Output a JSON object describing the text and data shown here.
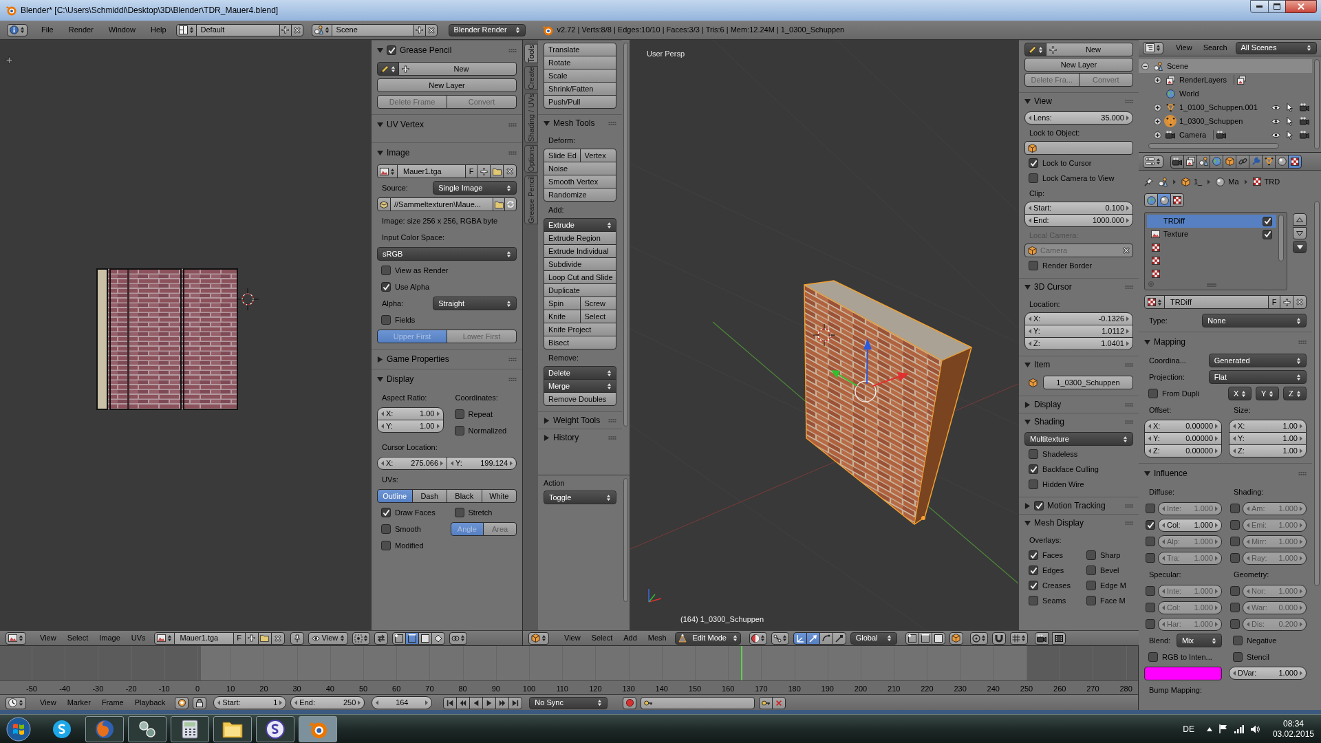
{
  "window": {
    "title": "Blender* [C:\\Users\\Schmiddi\\Desktop\\3D\\Blender\\TDR_Mauer4.blend]"
  },
  "info_header": {
    "menus": [
      "File",
      "Render",
      "Window",
      "Help"
    ],
    "layout": "Default",
    "scene": "Scene",
    "engine": "Blender Render",
    "stats": "v2.72 | Verts:8/8 | Edges:10/10 | Faces:3/3 | Tris:6 | Mem:12.24M | 1_0300_Schuppen"
  },
  "image_editor": {
    "sidebar": [
      {
        "title": "Grease Pencil",
        "expanded": true,
        "checkbox": true,
        "rows": [
          {
            "kind": "new_row",
            "label": "New"
          },
          {
            "kind": "group",
            "rows": [
              [
                {
                  "kind": "button",
                  "label": "New Layer"
                }
              ]
            ]
          },
          {
            "kind": "group",
            "rows": [
              [
                {
                  "kind": "button",
                  "label": "Delete Frame",
                  "disabled": true
                },
                {
                  "kind": "button",
                  "label": "Convert",
                  "disabled": true
                }
              ]
            ]
          }
        ]
      },
      {
        "title": "UV Vertex",
        "expanded": true
      },
      {
        "title": "Image",
        "expanded": true,
        "rows": [
          {
            "kind": "datablock",
            "value": "Mauer1.tga",
            "fake_user": "F"
          },
          {
            "kind": "dropdown",
            "label": "Source:",
            "value": "Single Image"
          },
          {
            "kind": "path",
            "value": "//Sammeltexturen\\Maue..."
          },
          {
            "kind": "label",
            "text": "Image: size 256 x 256, RGBA byte"
          },
          {
            "kind": "label",
            "text": "Input Color Space:"
          },
          {
            "kind": "dropdown",
            "value": "sRGB"
          },
          {
            "kind": "checkbox",
            "label": "View as Render",
            "checked": false
          },
          {
            "kind": "checkbox",
            "label": "Use Alpha",
            "checked": true
          },
          {
            "kind": "dropdown",
            "label": "Alpha:",
            "value": "Straight"
          },
          {
            "kind": "checkbox",
            "label": "Fields",
            "checked": false
          },
          {
            "kind": "group",
            "rows": [
              [
                {
                  "kind": "button",
                  "label": "Upper First",
                  "selected": true,
                  "disabled": true
                },
                {
                  "kind": "button",
                  "label": "Lower First",
                  "selected": false,
                  "disabled": true
                }
              ]
            ]
          }
        ]
      },
      {
        "title": "Game Properties",
        "expanded": false
      },
      {
        "title": "Display",
        "expanded": true,
        "rows": [
          {
            "kind": "columns",
            "columns": [
              [
                {
                  "kind": "label",
                  "text": "Aspect Ratio:"
                },
                {
                  "kind": "fields",
                  "items": [
                    {
                      "label": "X:",
                      "value": "1.00"
                    },
                    {
                      "label": "Y:",
                      "value": "1.00"
                    }
                  ]
                }
              ],
              [
                {
                  "kind": "label",
                  "text": "Coordinates:"
                },
                {
                  "kind": "checkbox",
                  "label": "Repeat",
                  "checked": false
                },
                {
                  "kind": "checkbox",
                  "label": "Normalized",
                  "checked": false
                }
              ]
            ]
          },
          {
            "kind": "label",
            "text": "Cursor Location:"
          },
          {
            "kind": "fields_row",
            "items": [
              {
                "label": "X:",
                "value": "275.066"
              },
              {
                "label": "Y:",
                "value": "199.124"
              }
            ]
          },
          {
            "kind": "label",
            "text": "UVs:"
          },
          {
            "kind": "group",
            "rows": [
              [
                {
                  "kind": "button",
                  "label": "Outline",
                  "selected": true
                },
                {
                  "kind": "button",
                  "label": "Dash",
                  "selected": false
                },
                {
                  "kind": "button",
                  "label": "Black",
                  "selected": false
                },
                {
                  "kind": "button",
                  "label": "White",
                  "selected": false
                }
              ]
            ]
          },
          {
            "kind": "columns",
            "columns": [
              [
                {
                  "kind": "checkbox",
                  "label": "Draw Faces",
                  "checked": true
                },
                {
                  "kind": "checkbox",
                  "label": "Smooth",
                  "checked": false
                },
                {
                  "kind": "checkbox",
                  "label": "Modified",
                  "checked": false
                }
              ],
              [
                {
                  "kind": "checkbox",
                  "label": "Stretch",
                  "checked": false
                },
                {
                  "kind": "group",
                  "rows": [
                    [
                      {
                        "kind": "button",
                        "label": "Angle",
                        "selected": true,
                        "disabled": true
                      },
                      {
                        "kind": "button",
                        "label": "Area",
                        "selected": false,
                        "disabled": true
                      }
                    ]
                  ]
                }
              ]
            ]
          }
        ]
      }
    ],
    "header": {
      "menus": [
        "View",
        "Select",
        "Image",
        "UVs"
      ],
      "image": "Mauer1.tga",
      "fake_user": "F",
      "view_mode": "View"
    }
  },
  "view3d": {
    "tool_tabs": [
      {
        "label": "Tools",
        "selected": true
      },
      {
        "label": "Create",
        "selected": false
      },
      {
        "label": "Shading / UVs",
        "selected": false
      },
      {
        "label": "Options",
        "selected": false
      },
      {
        "label": "Grease Pencil",
        "selected": false
      }
    ],
    "tool_panels": [
      {
        "rows": [
          {
            "kind": "group",
            "rows": [
              [
                {
                  "kind": "button",
                  "label": "Translate"
                }
              ],
              [
                {
                  "kind": "button",
                  "label": "Rotate"
                }
              ],
              [
                {
                  "kind": "button",
                  "label": "Scale"
                }
              ],
              [
                {
                  "kind": "button",
                  "label": "Shrink/Fatten"
                }
              ],
              [
                {
                  "kind": "button",
                  "label": "Push/Pull"
                }
              ]
            ]
          }
        ]
      },
      {
        "title": "Mesh Tools",
        "expanded": true,
        "rows": [
          {
            "kind": "label",
            "text": "Deform:"
          },
          {
            "kind": "group",
            "rows": [
              [
                {
                  "kind": "button",
                  "label": "Slide Ed"
                },
                {
                  "kind": "button",
                  "label": "Vertex"
                }
              ],
              [
                {
                  "kind": "button",
                  "label": "Noise"
                }
              ],
              [
                {
                  "kind": "button",
                  "label": "Smooth Vertex"
                }
              ],
              [
                {
                  "kind": "button",
                  "label": "Randomize"
                }
              ]
            ]
          },
          {
            "kind": "label",
            "text": "Add:"
          },
          {
            "kind": "group",
            "rows": [
              [
                {
                  "kind": "menu",
                  "label": "Extrude"
                }
              ],
              [
                {
                  "kind": "button",
                  "label": "Extrude Region"
                }
              ],
              [
                {
                  "kind": "button",
                  "label": "Extrude Individual"
                }
              ],
              [
                {
                  "kind": "button",
                  "label": "Subdivide"
                }
              ],
              [
                {
                  "kind": "button",
                  "label": "Loop Cut and Slide"
                }
              ],
              [
                {
                  "kind": "button",
                  "label": "Duplicate"
                }
              ],
              [
                {
                  "kind": "button",
                  "label": "Spin"
                },
                {
                  "kind": "button",
                  "label": "Screw"
                }
              ],
              [
                {
                  "kind": "button",
                  "label": "Knife"
                },
                {
                  "kind": "button",
                  "label": "Select"
                }
              ],
              [
                {
                  "kind": "button",
                  "label": "Knife Project"
                }
              ],
              [
                {
                  "kind": "button",
                  "label": "Bisect"
                }
              ]
            ]
          },
          {
            "kind": "label",
            "text": "Remove:"
          },
          {
            "kind": "group",
            "rows": [
              [
                {
                  "kind": "menu",
                  "label": "Delete"
                }
              ],
              [
                {
                  "kind": "menu",
                  "label": "Merge"
                }
              ],
              [
                {
                  "kind": "button",
                  "label": "Remove Doubles"
                }
              ]
            ]
          }
        ]
      },
      {
        "title": "Weight Tools",
        "expanded": false
      },
      {
        "title": "History",
        "expanded": false
      }
    ],
    "operator": {
      "title": "Action",
      "value": "Toggle"
    },
    "viewport": {
      "view_name": "User Persp",
      "object_info": "(164) 1_0300_Schuppen"
    },
    "sidebar": [
      {
        "rows": [
          {
            "kind": "new_row",
            "label": "New"
          },
          {
            "kind": "group",
            "rows": [
              [
                {
                  "kind": "button",
                  "label": "New Layer"
                }
              ]
            ]
          },
          {
            "kind": "group",
            "rows": [
              [
                {
                  "kind": "button",
                  "label": "Delete Fra...",
                  "disabled": true
                },
                {
                  "kind": "button",
                  "label": "Convert",
                  "disabled": true
                }
              ]
            ]
          }
        ]
      },
      {
        "title": "View",
        "expanded": true,
        "rows": [
          {
            "kind": "fields",
            "items": [
              {
                "label": "Lens:",
                "value": "35.000"
              }
            ]
          },
          {
            "kind": "label",
            "text": "Lock to Object:"
          },
          {
            "kind": "object_field"
          },
          {
            "kind": "checkbox",
            "label": "Lock to Cursor",
            "checked": true
          },
          {
            "kind": "checkbox",
            "label": "Lock Camera to View",
            "checked": false
          },
          {
            "kind": "label",
            "text": "Clip:"
          },
          {
            "kind": "fields",
            "items": [
              {
                "label": "Start:",
                "value": "0.100"
              },
              {
                "label": "End:",
                "value": "1000.000"
              }
            ]
          },
          {
            "kind": "label",
            "text": "Local Camera:",
            "disabled": true
          },
          {
            "kind": "object_field",
            "value": "Camera",
            "disabled": true
          },
          {
            "kind": "checkbox",
            "label": "Render Border",
            "checked": false
          }
        ]
      },
      {
        "title": "3D Cursor",
        "expanded": true,
        "rows": [
          {
            "kind": "label",
            "text": "Location:"
          },
          {
            "kind": "fields",
            "items": [
              {
                "label": "X:",
                "value": "-0.1326"
              },
              {
                "label": "Y:",
                "value": "1.0112"
              },
              {
                "label": "Z:",
                "value": "1.0401"
              }
            ]
          }
        ]
      },
      {
        "title": "Item",
        "expanded": true,
        "rows": [
          {
            "kind": "name_field",
            "value": "1_0300_Schuppen"
          }
        ]
      },
      {
        "title": "Display",
        "expanded": false
      },
      {
        "title": "Shading",
        "expanded": true,
        "rows": [
          {
            "kind": "dropdown",
            "value": "Multitexture"
          },
          {
            "kind": "checkbox",
            "label": "Shadeless",
            "checked": false
          },
          {
            "kind": "checkbox",
            "label": "Backface Culling",
            "checked": true
          },
          {
            "kind": "checkbox",
            "label": "Hidden Wire",
            "checked": false
          }
        ]
      },
      {
        "title": "Motion Tracking",
        "expanded": false,
        "checkbox": true
      },
      {
        "title": "Mesh Display",
        "expanded": true,
        "rows": [
          {
            "kind": "label",
            "text": "Overlays:"
          },
          {
            "kind": "columns",
            "columns": [
              [
                {
                  "kind": "checkbox",
                  "label": "Faces",
                  "checked": true
                },
                {
                  "kind": "checkbox",
                  "label": "Edges",
                  "checked": true
                },
                {
                  "kind": "checkbox",
                  "label": "Creases",
                  "checked": true
                },
                {
                  "kind": "checkbox",
                  "label": "Seams",
                  "checked": false
                }
              ],
              [
                {
                  "kind": "checkbox",
                  "label": "Sharp",
                  "checked": false
                },
                {
                  "kind": "checkbox",
                  "label": "Bevel",
                  "checked": false
                },
                {
                  "kind": "checkbox",
                  "label": "Edge M",
                  "checked": false
                },
                {
                  "kind": "checkbox",
                  "label": "Face M",
                  "checked": false
                }
              ]
            ]
          }
        ]
      }
    ],
    "header": {
      "menus": [
        "View",
        "Select",
        "Add",
        "Mesh"
      ],
      "mode": "Edit Mode",
      "manipulators": [
        {
          "selected": true
        },
        {
          "selected": true
        },
        {
          "selected": false
        },
        {
          "selected": false
        }
      ],
      "orientation": "Global"
    }
  },
  "outliner": {
    "menus": [
      "View",
      "Search"
    ],
    "display_mode": "All Scenes",
    "tree": [
      {
        "name": "Scene",
        "kind": "scene",
        "expanded": true,
        "selected": true,
        "children": [
          {
            "name": "RenderLayers",
            "kind": "renderlayers",
            "expanded": false,
            "selected": false,
            "active": false
          },
          {
            "name": "World",
            "kind": "world",
            "selected": false,
            "active": false
          },
          {
            "name": "1_0100_Schuppen.001",
            "kind": "mesh",
            "expanded": false,
            "selected": false,
            "active": false
          },
          {
            "name": "1_0300_Schuppen",
            "kind": "mesh",
            "expanded": false,
            "selected": false,
            "active": true
          },
          {
            "name": "Camera",
            "kind": "camera",
            "expanded": false,
            "selected": false,
            "active": false
          }
        ]
      }
    ]
  },
  "properties": {
    "context_tabs": [
      {
        "kind": "render",
        "selected": false
      },
      {
        "kind": "render_layers",
        "selected": false
      },
      {
        "kind": "scene",
        "selected": false
      },
      {
        "kind": "world",
        "selected": false
      },
      {
        "kind": "object",
        "selected": false
      },
      {
        "kind": "constraints",
        "selected": false
      },
      {
        "kind": "modifiers",
        "selected": false
      },
      {
        "kind": "data",
        "selected": false
      },
      {
        "kind": "material",
        "selected": false
      },
      {
        "kind": "texture",
        "selected": true
      }
    ],
    "breadcrumb": [
      {
        "kind": "scene"
      },
      {
        "kind": "object",
        "label": "1_"
      },
      {
        "kind": "material",
        "label": "Ma"
      },
      {
        "kind": "texture",
        "label": "TRD"
      }
    ],
    "texture_contexts": [
      {
        "kind": "world",
        "selected": false
      },
      {
        "kind": "material",
        "selected": true
      },
      {
        "kind": "texture",
        "selected": false
      }
    ],
    "slots": [
      {
        "name": "TRDiff",
        "kind": "blank",
        "selected": true,
        "checked": true
      },
      {
        "name": "Texture",
        "kind": "image",
        "selected": false,
        "checked": true
      },
      {
        "kind": "texture",
        "selected": false
      },
      {
        "kind": "texture",
        "selected": false
      },
      {
        "kind": "texture",
        "selected": false
      }
    ],
    "texture_name": "TRDiff",
    "fake_user": "F",
    "type": {
      "label": "Type:",
      "value": "None"
    },
    "panels": [
      {
        "title": "Mapping",
        "expanded": true,
        "rows": [
          {
            "kind": "dropdown",
            "label": "Coordina...",
            "value": "Generated"
          },
          {
            "kind": "dropdown",
            "label": "Projection:",
            "value": "Flat"
          },
          {
            "kind": "check_menus",
            "label": "From Dupli",
            "checked": false,
            "menus": [
              "X",
              "Y",
              "Z"
            ]
          },
          {
            "kind": "columns",
            "columns": [
              [
                {
                  "kind": "label",
                  "text": "Offset:"
                },
                {
                  "kind": "fields",
                  "items": [
                    {
                      "label": "X:",
                      "value": "0.00000"
                    },
                    {
                      "label": "Y:",
                      "value": "0.00000"
                    },
                    {
                      "label": "Z:",
                      "value": "0.00000"
                    }
                  ]
                }
              ],
              [
                {
                  "kind": "label",
                  "text": "Size:"
                },
                {
                  "kind": "fields",
                  "items": [
                    {
                      "label": "X:",
                      "value": "1.00"
                    },
                    {
                      "label": "Y:",
                      "value": "1.00"
                    },
                    {
                      "label": "Z:",
                      "value": "1.00"
                    }
                  ]
                }
              ]
            ]
          }
        ]
      },
      {
        "title": "Influence",
        "expanded": true,
        "rows": [
          {
            "kind": "columns",
            "columns": [
              [
                {
                  "kind": "label",
                  "text": "Diffuse:"
                },
                {
                  "kind": "check_field",
                  "checked": false,
                  "label": "Inte:",
                  "value": "1.000"
                },
                {
                  "kind": "check_field",
                  "checked": true,
                  "label": "Col:",
                  "value": "1.000"
                },
                {
                  "kind": "check_field",
                  "checked": false,
                  "label": "Alp:",
                  "value": "1.000"
                },
                {
                  "kind": "check_field",
                  "checked": false,
                  "label": "Tra:",
                  "value": "1.000"
                }
              ],
              [
                {
                  "kind": "label",
                  "text": "Shading:"
                },
                {
                  "kind": "check_field",
                  "checked": false,
                  "label": "Am:",
                  "value": "1.000"
                },
                {
                  "kind": "check_field",
                  "checked": false,
                  "label": "Emi:",
                  "value": "1.000"
                },
                {
                  "kind": "check_field",
                  "checked": false,
                  "label": "Mirr:",
                  "value": "1.000"
                },
                {
                  "kind": "check_field",
                  "checked": false,
                  "label": "Ray:",
                  "value": "1.000"
                }
              ]
            ]
          },
          {
            "kind": "columns",
            "columns": [
              [
                {
                  "kind": "label",
                  "text": "Specular:"
                },
                {
                  "kind": "check_field",
                  "checked": false,
                  "label": "Inte:",
                  "value": "1.000"
                },
                {
                  "kind": "check_field",
                  "checked": false,
                  "label": "Col:",
                  "value": "1.000"
                },
                {
                  "kind": "check_field",
                  "checked": false,
                  "label": "Har:",
                  "value": "1.000"
                }
              ],
              [
                {
                  "kind": "label",
                  "text": "Geometry:"
                },
                {
                  "kind": "check_field",
                  "checked": false,
                  "label": "Nor:",
                  "value": "1.000"
                },
                {
                  "kind": "check_field",
                  "checked": false,
                  "label": "War:",
                  "value": "0.000"
                },
                {
                  "kind": "check_field",
                  "checked": false,
                  "label": "Dis:",
                  "value": "0.200"
                }
              ]
            ]
          },
          {
            "kind": "columns",
            "columns": [
              [
                {
                  "kind": "dropdown",
                  "label": "Blend:",
                  "value": "Mix"
                },
                {
                  "kind": "checkbox",
                  "label": "RGB to Inten...",
                  "checked": false
                },
                {
                  "kind": "swatch",
                  "color": "#ff00ff"
                }
              ],
              [
                {
                  "kind": "checkbox",
                  "label": "Negative",
                  "checked": false
                },
                {
                  "kind": "checkbox",
                  "label": "Stencil",
                  "checked": false
                },
                {
                  "kind": "fields",
                  "items": [
                    {
                      "label": "DVar:",
                      "value": "1.000"
                    }
                  ]
                }
              ]
            ]
          },
          {
            "kind": "label",
            "text": "Bump Mapping:"
          }
        ]
      }
    ]
  },
  "timeline": {
    "ticks": [
      "-50",
      "-40",
      "-30",
      "-20",
      "-10",
      "0",
      "10",
      "20",
      "30",
      "40",
      "50",
      "60",
      "70",
      "80",
      "90",
      "100",
      "110",
      "120",
      "130",
      "140",
      "150",
      "160",
      "170",
      "180",
      "190",
      "200",
      "210",
      "220",
      "230",
      "240",
      "250",
      "260",
      "270",
      "280"
    ],
    "header": {
      "menus": [
        "View",
        "Marker",
        "Frame",
        "Playback"
      ],
      "start": {
        "label": "Start:",
        "value": "1"
      },
      "end": {
        "label": "End:",
        "value": "250"
      },
      "current": "164",
      "sync": "No Sync"
    }
  },
  "taskbar": {
    "apps": [
      {
        "kind": "skype",
        "running": false,
        "selected": false
      },
      {
        "kind": "firefox",
        "running": true,
        "selected": false
      },
      {
        "kind": "network",
        "running": true,
        "selected": false
      },
      {
        "kind": "calculator",
        "running": true,
        "selected": false
      },
      {
        "kind": "explorer",
        "running": true,
        "selected": false
      },
      {
        "kind": "s_app",
        "running": true,
        "selected": false
      },
      {
        "kind": "blender",
        "running": true,
        "selected": true
      }
    ],
    "language": "DE",
    "time": "08:34",
    "date": "03.02.2015"
  }
}
